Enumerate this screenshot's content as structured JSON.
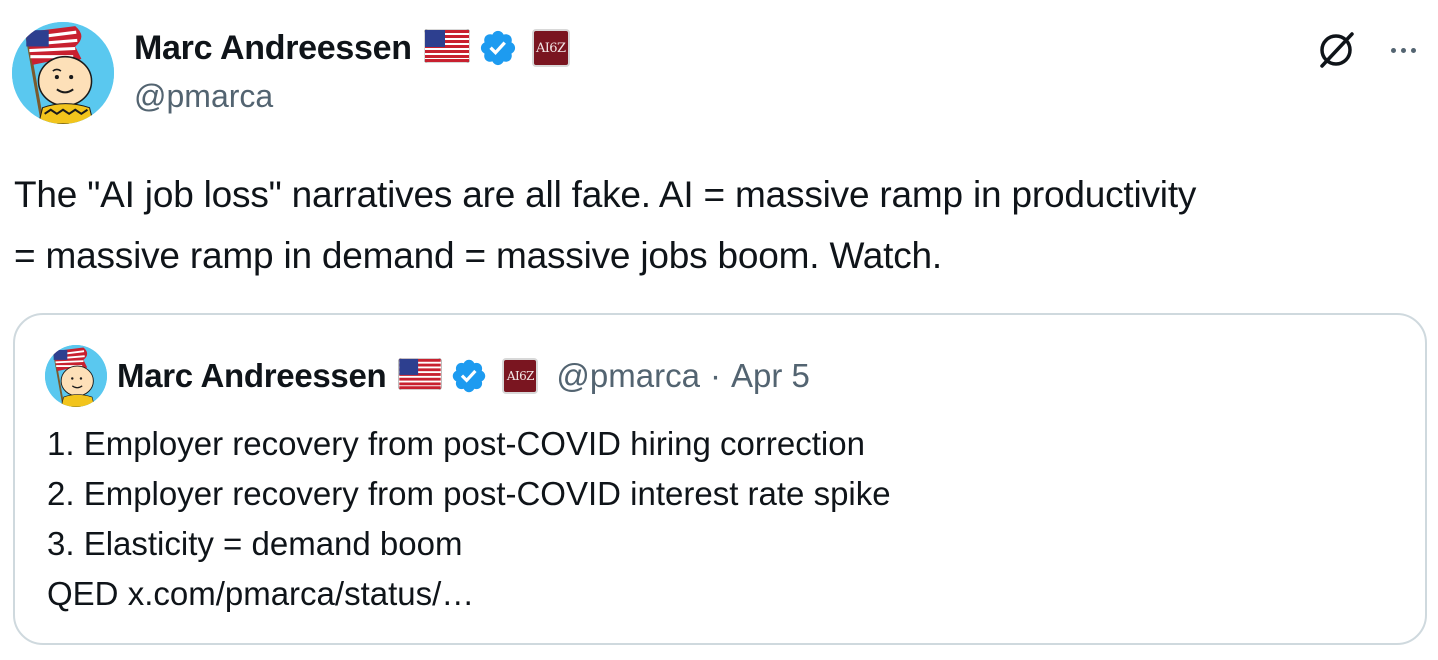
{
  "author": {
    "display_name": "Marc Andreessen",
    "handle": "@pmarca",
    "badges": [
      "us-flag-icon",
      "verified-badge-icon",
      "a16z-affiliate-icon"
    ],
    "affiliate_label": "AI6Z",
    "verified_color": "#1d9bf0"
  },
  "header_actions": {
    "grok_icon": "grok-icon",
    "more_icon": "more-options-icon"
  },
  "tweet": {
    "lines": [
      "The \"AI job loss\" narratives are all fake. AI = massive ramp in productivity",
      "= massive ramp in demand = massive jobs boom. Watch."
    ]
  },
  "quoted_tweet": {
    "display_name": "Marc Andreessen",
    "handle": "@pmarca",
    "separator": "·",
    "date": "Apr 5",
    "affiliate_label": "AI6Z",
    "lines": [
      "1. Employer recovery from post-COVID hiring correction",
      "2. Employer recovery from post-COVID interest rate spike",
      "3. Elasticity = demand boom"
    ],
    "last_line_prefix": "QED",
    "link_text": "x.com/pmarca/status/…"
  },
  "colors": {
    "text_primary": "#0f1419",
    "text_secondary": "#536471",
    "border": "#cfd9de",
    "avatar_bg": "#5ac8ef",
    "affiliate_bg": "#7a1520"
  }
}
